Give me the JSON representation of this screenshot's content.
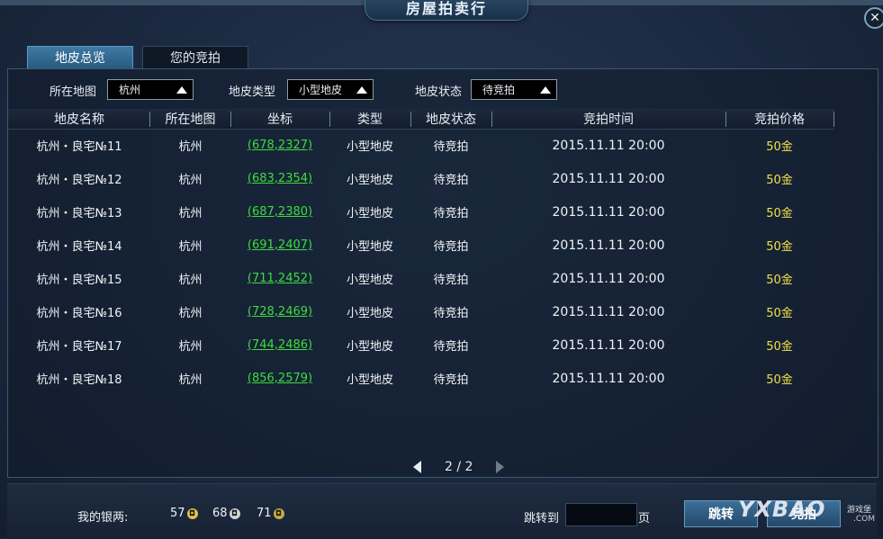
{
  "window": {
    "title": "房屋拍卖行",
    "close": "✕"
  },
  "tabs": [
    {
      "label": "地皮总览",
      "active": true
    },
    {
      "label": "您的竞拍",
      "active": false
    }
  ],
  "filters": {
    "map": {
      "label": "所在地图",
      "value": "杭州"
    },
    "type": {
      "label": "地皮类型",
      "value": "小型地皮"
    },
    "status": {
      "label": "地皮状态",
      "value": "待竞拍"
    }
  },
  "table": {
    "headers": [
      "地皮名称",
      "所在地图",
      "坐标",
      "类型",
      "地皮状态",
      "竞拍时间",
      "竞拍价格"
    ],
    "rows": [
      {
        "name": "杭州・良宅№11",
        "map": "杭州",
        "coord": "(678,2327)",
        "type": "小型地皮",
        "status": "待竞拍",
        "time": "2015.11.11 20:00",
        "price": "50金"
      },
      {
        "name": "杭州・良宅№12",
        "map": "杭州",
        "coord": "(683,2354)",
        "type": "小型地皮",
        "status": "待竞拍",
        "time": "2015.11.11 20:00",
        "price": "50金"
      },
      {
        "name": "杭州・良宅№13",
        "map": "杭州",
        "coord": "(687,2380)",
        "type": "小型地皮",
        "status": "待竞拍",
        "time": "2015.11.11 20:00",
        "price": "50金"
      },
      {
        "name": "杭州・良宅№14",
        "map": "杭州",
        "coord": "(691,2407)",
        "type": "小型地皮",
        "status": "待竞拍",
        "time": "2015.11.11 20:00",
        "price": "50金"
      },
      {
        "name": "杭州・良宅№15",
        "map": "杭州",
        "coord": "(711,2452)",
        "type": "小型地皮",
        "status": "待竞拍",
        "time": "2015.11.11 20:00",
        "price": "50金"
      },
      {
        "name": "杭州・良宅№16",
        "map": "杭州",
        "coord": "(728,2469)",
        "type": "小型地皮",
        "status": "待竞拍",
        "time": "2015.11.11 20:00",
        "price": "50金"
      },
      {
        "name": "杭州・良宅№17",
        "map": "杭州",
        "coord": "(744,2486)",
        "type": "小型地皮",
        "status": "待竞拍",
        "time": "2015.11.11 20:00",
        "price": "50金"
      },
      {
        "name": "杭州・良宅№18",
        "map": "杭州",
        "coord": "(856,2579)",
        "type": "小型地皮",
        "status": "待竞拍",
        "time": "2015.11.11 20:00",
        "price": "50金"
      }
    ]
  },
  "pager": {
    "text": "2 / 2"
  },
  "footer": {
    "money_label": "我的银两:",
    "gold": "57",
    "silver": "68",
    "copper": "71",
    "jump_label": "跳转到",
    "jump_value": "",
    "page_unit": "页",
    "jump_button": "跳转",
    "bid_button": "竞拍"
  },
  "watermark": {
    "text": "YXBAO",
    "sub": "游戏堡",
    "sub2": ".COM"
  },
  "colors": {
    "coord_link": "#3ddc3d",
    "price": "#f2e04a",
    "tab_active": "#3f7aa4"
  }
}
